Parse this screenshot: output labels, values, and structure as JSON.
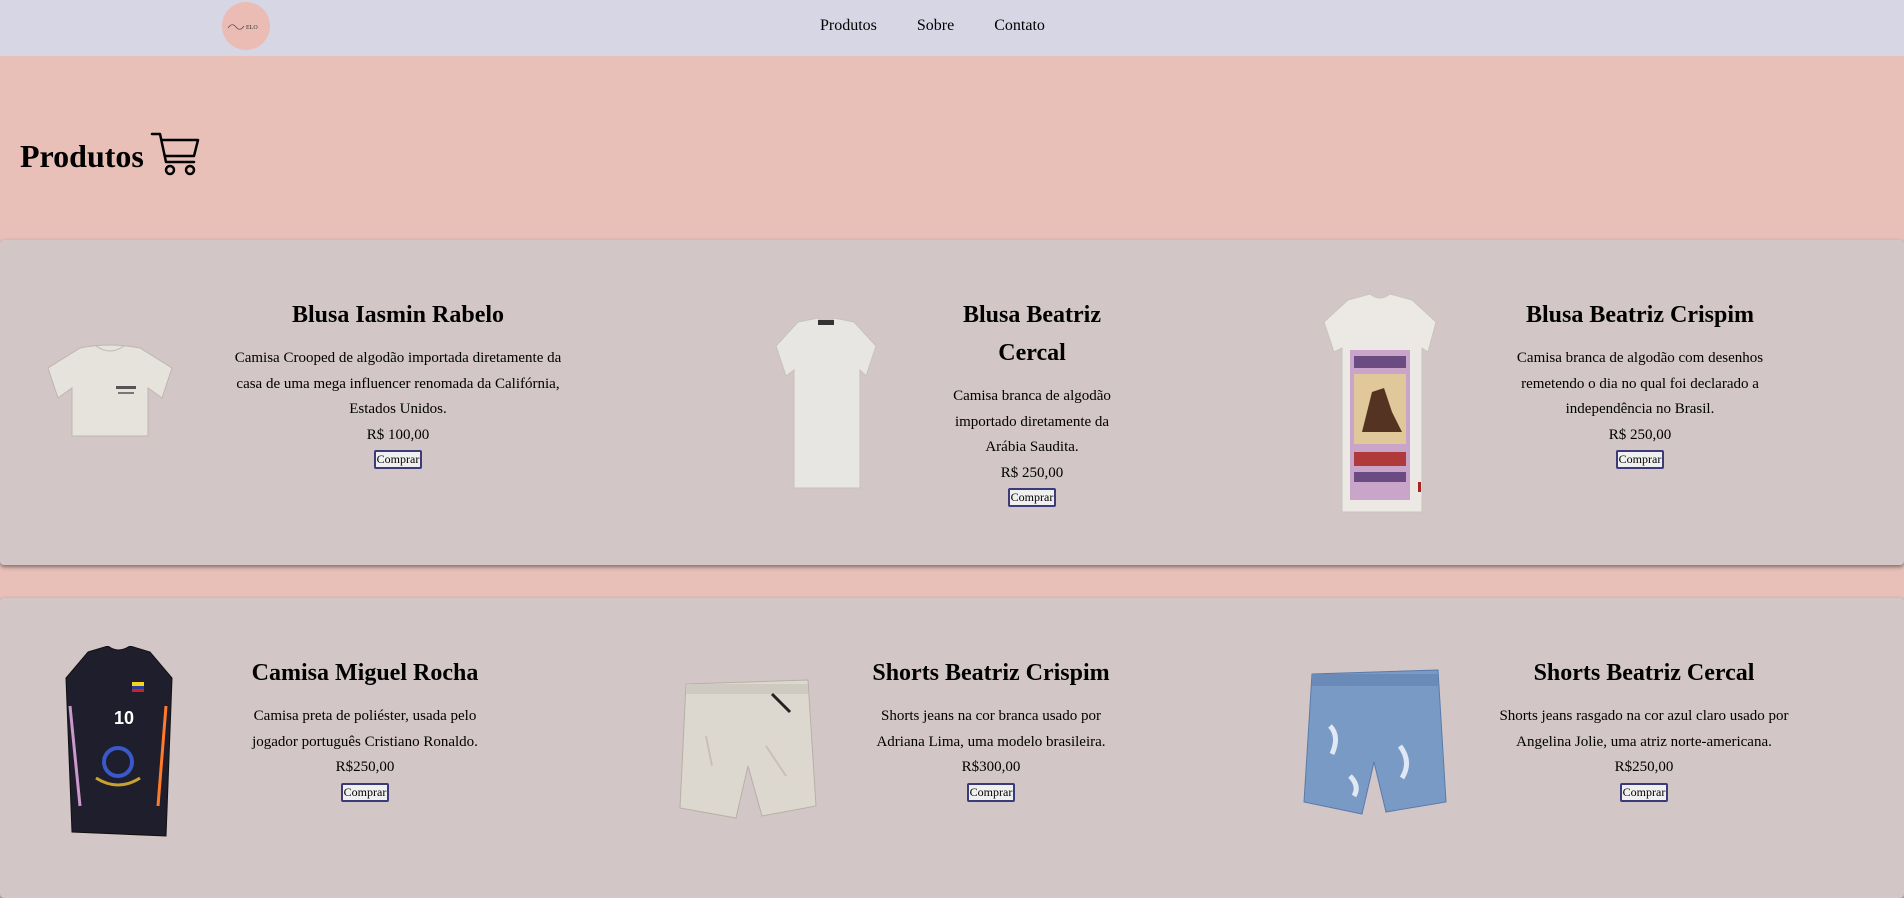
{
  "nav": {
    "logo_text": "ELO",
    "links": [
      {
        "label": "Produtos"
      },
      {
        "label": "Sobre"
      },
      {
        "label": "Contato"
      }
    ]
  },
  "hero": {
    "title": "Produtos"
  },
  "products": [
    {
      "name": "Blusa Iasmin Rabelo",
      "description": "Camisa Crooped de algodão importada diretamente da casa de uma mega influencer renomada da Califórnia, Estados Unidos.",
      "price": "R$ 100,00",
      "button": "Comprar"
    },
    {
      "name": "Blusa Beatriz Cercal",
      "description": "Camisa branca de algodão importado diretamente da Arábia Saudita.",
      "price": "R$ 250,00",
      "button": "Comprar"
    },
    {
      "name": "Blusa Beatriz Crispim",
      "description": "Camisa branca de algodão com desenhos remetendo o dia no qual foi declarado a independência no Brasil.",
      "price": "R$ 250,00",
      "button": "Comprar"
    },
    {
      "name": "Camisa Miguel Rocha",
      "description": "Camisa preta de poliéster, usada pelo jogador português Cristiano Ronaldo.",
      "price": "R$250,00",
      "button": "Comprar"
    },
    {
      "name": "Shorts Beatriz Crispim",
      "description": "Shorts jeans na cor branca usado por Adriana Lima, uma modelo brasileira.",
      "price": "R$300,00",
      "button": "Comprar"
    },
    {
      "name": "Shorts Beatriz Cercal",
      "description": "Shorts jeans rasgado na cor azul claro usado por Angelina Jolie, uma atriz norte-americana.",
      "price": "R$250,00",
      "button": "Comprar"
    }
  ],
  "icons": {
    "cart": "shopping-cart-icon",
    "logo": "logo-icon"
  },
  "colors": {
    "navbar_bg": "#d6d6e4",
    "page_bg": "#e8c0b8",
    "card_bg": "#d2c6c6",
    "logo_bg": "#ebbcb3"
  }
}
